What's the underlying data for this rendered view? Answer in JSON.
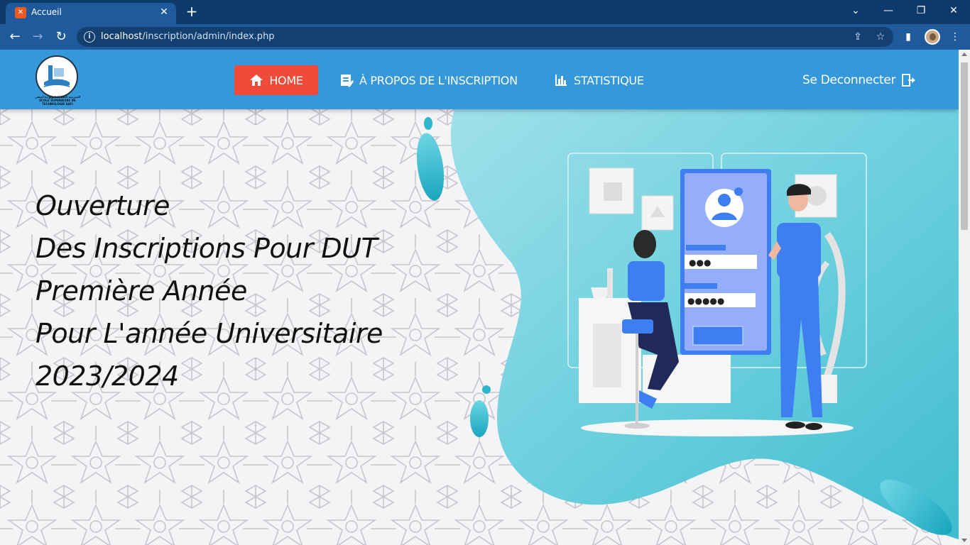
{
  "browser": {
    "tab_title": "Accueil",
    "tab_favicon": "xampp-icon",
    "url_host": "localhost",
    "url_path": "/inscription/admin/index.php"
  },
  "nav": {
    "home": "HOME",
    "about": "À PROPOS DE L'INSCRIPTION",
    "stats": "STATISTIQUE",
    "logout": "Se Deconnecter"
  },
  "logo": {
    "arabic": "المدرسة العليا للتكنولوجيا آسفي",
    "latin": "ECOLE SUPERIEURE DE TECHNOLOGIE SAFI"
  },
  "hero": {
    "lines": [
      "Ouverture",
      "Des Inscriptions Pour DUT",
      "Première Année",
      "Pour L'année Universitaire",
      "2023/2024"
    ]
  },
  "illustration": {
    "password_dots_1": "●●●",
    "password_dots_2": "●●●●●"
  },
  "colors": {
    "header": "#3498db",
    "home_active": "#f04a3a",
    "blob": "#5cc8d8",
    "accent_blue": "#3e7ef0"
  }
}
